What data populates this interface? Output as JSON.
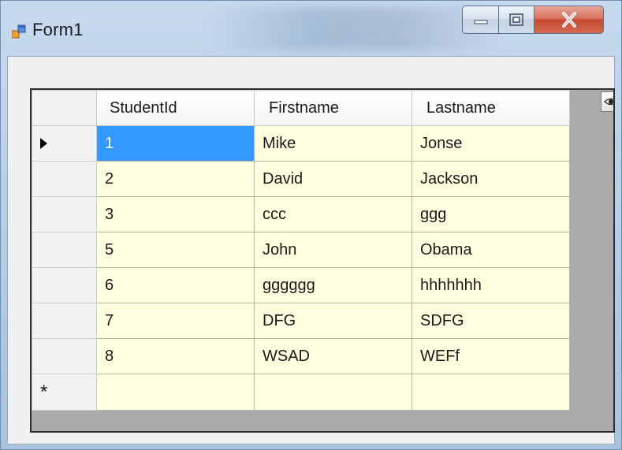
{
  "window": {
    "title": "Form1"
  },
  "grid": {
    "columns": [
      "StudentId",
      "Firstname",
      "Lastname"
    ],
    "rows": [
      [
        "1",
        "Mike",
        "Jonse"
      ],
      [
        "2",
        "David",
        "Jackson"
      ],
      [
        "3",
        "ccc",
        "ggg"
      ],
      [
        "5",
        "John",
        "Obama"
      ],
      [
        "6",
        "gggggg",
        "hhhhhhh"
      ],
      [
        "7",
        "DFG",
        "SDFG"
      ],
      [
        "8",
        "WSAD",
        "WEFf"
      ]
    ],
    "selected_row": 0,
    "new_row_marker": "*"
  },
  "colors": {
    "cell_background": "#ffffe0",
    "selection": "#3399ff",
    "grid_background": "#ababab"
  },
  "icons": {
    "app": "form-icon",
    "current_row": "current-row-arrow-icon",
    "column_chooser": "column-chooser-icon"
  }
}
